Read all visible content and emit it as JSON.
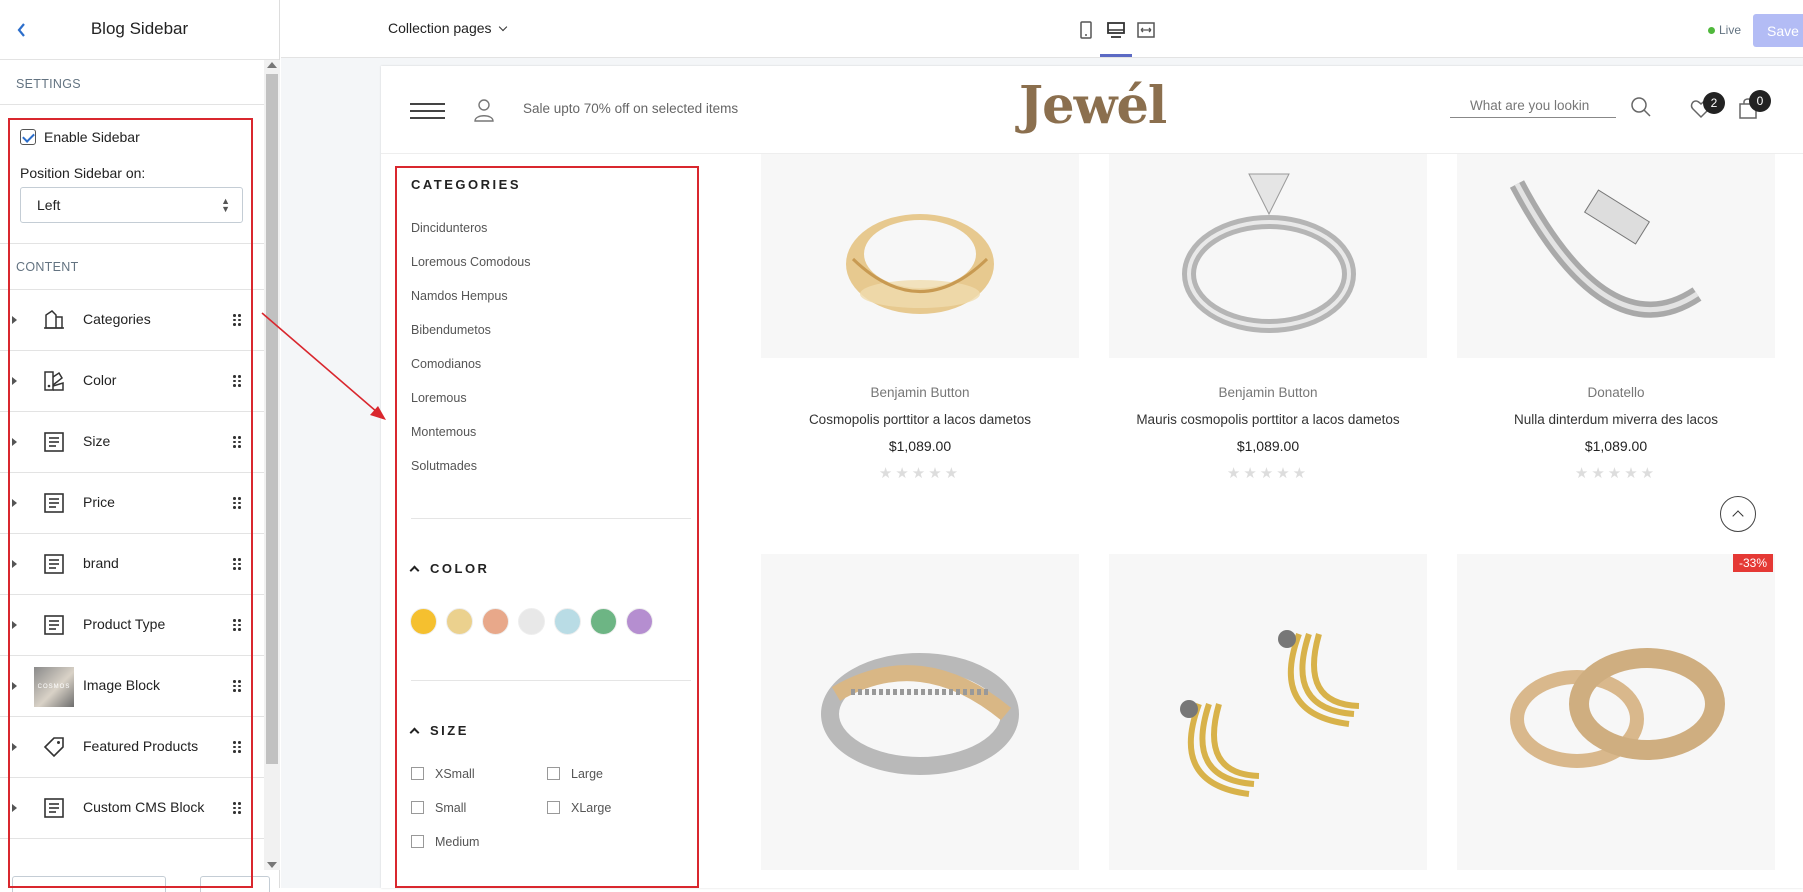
{
  "editor": {
    "title": "Blog Sidebar",
    "settings_label": "SETTINGS",
    "enable_sidebar_label": "Enable Sidebar",
    "position_label": "Position Sidebar on:",
    "position_value": "Left",
    "content_label": "CONTENT",
    "blocks": [
      {
        "label": "Categories",
        "icon": "categories-icon"
      },
      {
        "label": "Color",
        "icon": "color-icon"
      },
      {
        "label": "Size",
        "icon": "text-block-icon"
      },
      {
        "label": "Price",
        "icon": "text-block-icon"
      },
      {
        "label": "brand",
        "icon": "text-block-icon"
      },
      {
        "label": "Product Type",
        "icon": "text-block-icon"
      },
      {
        "label": "Image Block",
        "icon": "image-thumbnail"
      },
      {
        "label": "Featured Products",
        "icon": "tag-icon"
      },
      {
        "label": "Custom CMS Block",
        "icon": "text-block-icon"
      }
    ]
  },
  "topbar": {
    "page_select": "Collection pages",
    "live_label": "Live",
    "save_label": "Save"
  },
  "site": {
    "promo": "Sale upto 70% off on selected items",
    "logo": "Jewél",
    "search_placeholder": "What are you lookin",
    "wishlist_count": "2",
    "cart_count": "0"
  },
  "sidebar": {
    "categories_title": "CATEGORIES",
    "categories": [
      "Dincidunteros",
      "Loremous Comodous",
      "Namdos Hempus",
      "Bibendumetos",
      "Comodianos",
      "Loremous",
      "Montemous",
      "Solutmades"
    ],
    "color_title": "COLOR",
    "colors": [
      "#f5c02f",
      "#ebd18e",
      "#e8a88a",
      "#e8e8e8",
      "#b9dce5",
      "#6db584",
      "#b58ed0"
    ],
    "size_title": "SIZE",
    "sizes_col1": [
      "XSmall",
      "Small",
      "Medium"
    ],
    "sizes_col2": [
      "Large",
      "XLarge"
    ]
  },
  "products": [
    {
      "brand": "Benjamin Button",
      "name": "Cosmopolis porttitor a lacos dametos",
      "price": "$1,089.00"
    },
    {
      "brand": "Benjamin Button",
      "name": "Mauris cosmopolis porttitor a lacos dametos",
      "price": "$1,089.00"
    },
    {
      "brand": "Donatello",
      "name": "Nulla dinterdum miverra des lacos",
      "price": "$1,089.00"
    }
  ],
  "stars": "★★★★★",
  "sale_tag": "-33%",
  "thumb_text": "COSMOS"
}
